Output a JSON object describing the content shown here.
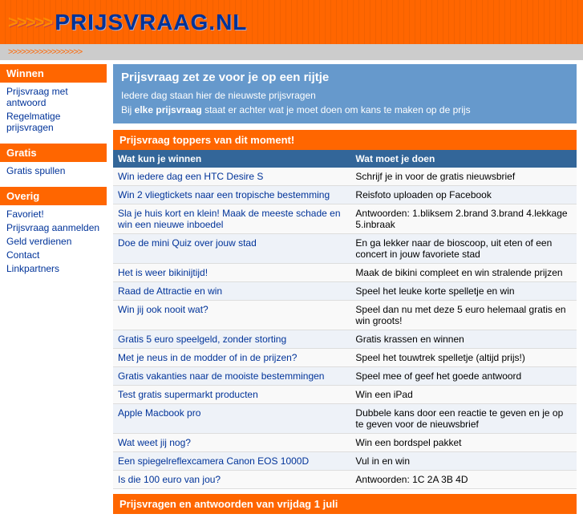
{
  "header": {
    "arrows": ">>>>>",
    "title": "PRIJSVRAAG.NL",
    "sub_arrows": ">>>>>>>>>>>>>>>>>"
  },
  "sidebar": {
    "sections": [
      {
        "label": "Winnen",
        "links": [
          {
            "text": "Prijsvraag met antwoord",
            "href": "#"
          },
          {
            "text": "Regelmatige prijsvragen",
            "href": "#"
          }
        ]
      },
      {
        "label": "Gratis",
        "links": [
          {
            "text": "Gratis spullen",
            "href": "#"
          }
        ]
      },
      {
        "label": "Overig",
        "links": [
          {
            "text": "Favoriet!",
            "href": "#"
          },
          {
            "text": "Prijsvraag aanmelden",
            "href": "#"
          },
          {
            "text": "Geld verdienen",
            "href": "#"
          },
          {
            "text": "Contact",
            "href": "#"
          },
          {
            "text": "Linkpartners",
            "href": "#"
          }
        ]
      }
    ]
  },
  "main": {
    "intro_title": "Prijsvraag zet ze voor je op een rijtje",
    "intro_line1": "Iedere dag staan hier de nieuwste prijsvragen",
    "intro_line2_prefix": "Bij ",
    "intro_line2_bold": "elke prijsvraag",
    "intro_line2_suffix": " staat er achter wat je moet doen om kans te maken op de prijs",
    "toppers_title": "Prijsvraag toppers van dit moment!",
    "table_header_win": "Wat kun je winnen",
    "table_header_do": "Wat moet je doen",
    "rows": [
      {
        "win": "Win iedere dag een HTC Desire S",
        "do": "Schrijf je in voor de gratis nieuwsbrief"
      },
      {
        "win": "Win 2 vliegtickets naar een tropische bestemming",
        "do": "Reisfoto uploaden op Facebook"
      },
      {
        "win": "Sla je huis kort en klein! Maak de meeste schade en win een nieuwe inboedel",
        "do": "Antwoorden: 1.bliksem 2.brand 3.brand 4.lekkage 5.inbraak"
      },
      {
        "win": "Doe de mini Quiz over jouw stad",
        "do": "En ga lekker naar de bioscoop, uit eten of een concert in jouw favoriete stad"
      },
      {
        "win": "Het is weer bikinijtijd!",
        "do": "Maak de bikini compleet en win stralende prijzen"
      },
      {
        "win": "Raad de Attractie en win",
        "do": "Speel het leuke korte spelletje en win"
      },
      {
        "win": "Win jij ook nooit wat?",
        "do": "Speel dan nu met deze 5 euro helemaal gratis en win groots!"
      },
      {
        "win": "Gratis 5 euro speelgeld, zonder storting",
        "do": "Gratis krassen en winnen"
      },
      {
        "win": "Met je neus in de modder of in de prijzen?",
        "do": "Speel het touwtrek spelletje (altijd prijs!)"
      },
      {
        "win": "Gratis vakanties naar de mooiste bestemmingen",
        "do": "Speel mee of geef het goede antwoord"
      },
      {
        "win": "Test gratis supermarkt producten",
        "do": "Win een iPad"
      },
      {
        "win": "Apple Macbook pro",
        "do": "Dubbele kans door een reactie te geven en je op te geven voor de nieuwsbrief"
      },
      {
        "win": "Wat weet jij nog?",
        "do": "Win een bordspel pakket"
      },
      {
        "win": "Een spiegelreflexcamera Canon EOS 1000D",
        "do": "Vul in en win"
      },
      {
        "win": "Is die 100 euro van jou?",
        "do": "Antwoorden: 1C 2A 3B 4D"
      }
    ],
    "bottom_title": "Prijsvragen en antwoorden van vrijdag 1 juli"
  }
}
